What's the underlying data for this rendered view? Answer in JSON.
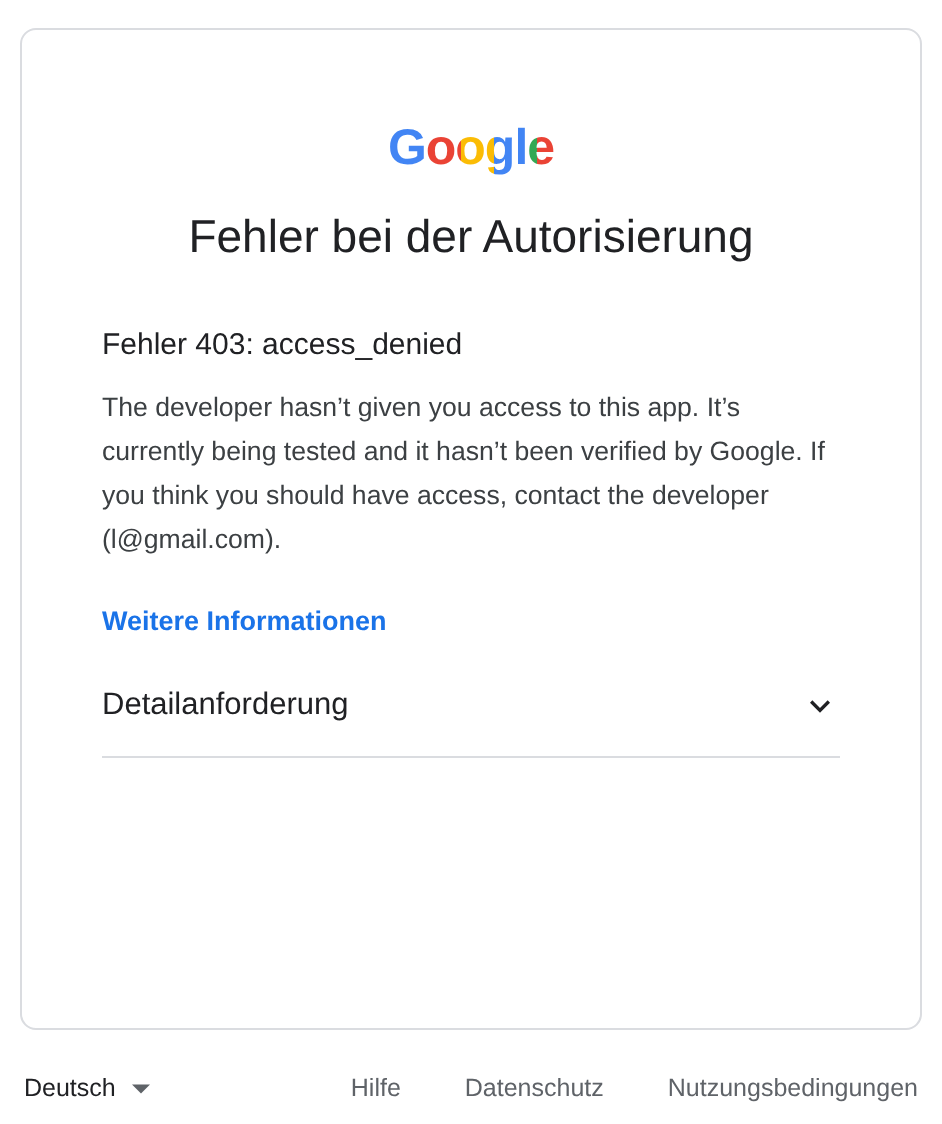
{
  "logo": "Google",
  "title": "Fehler bei der Autorisierung",
  "error_heading": "Fehler 403: access_denied",
  "message": "The developer hasn’t given you access to this app. It’s currently being tested and it hasn’t been verified by Google. If you think you should have access, contact the developer (l@gmail.com).",
  "link": "Weitere Informationen",
  "details": {
    "label": "Detailanforderung",
    "expanded": false
  },
  "footer": {
    "language": "Deutsch",
    "links": [
      "Hilfe",
      "Datenschutz",
      "Nutzungsbedingungen"
    ]
  }
}
